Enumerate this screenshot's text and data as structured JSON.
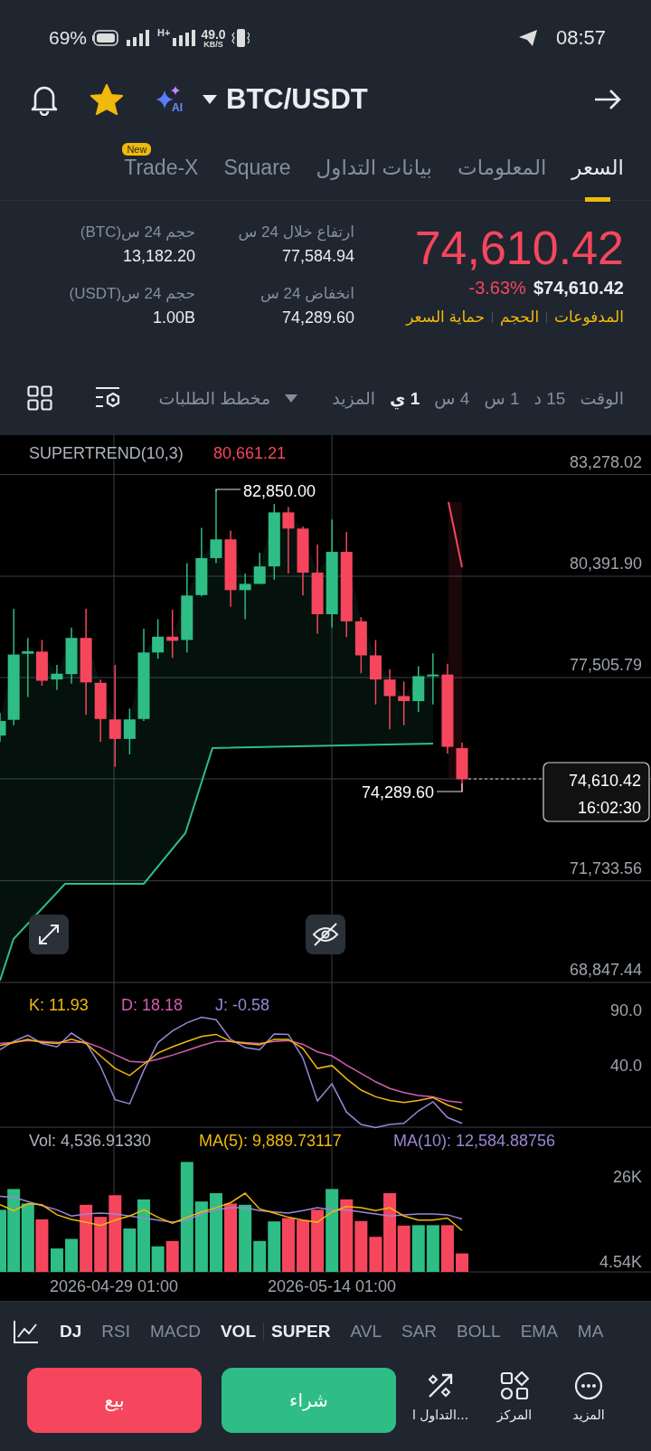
{
  "status_bar": {
    "battery": "69%",
    "network_type": "H+",
    "speed": "49.0",
    "speed_unit": "KB/S",
    "time": "08:57"
  },
  "header": {
    "pair": "BTC/USDT",
    "favorite": true,
    "ai_label": "AI"
  },
  "tabs": [
    {
      "label": "السعر",
      "selected": true
    },
    {
      "label": "المعلومات",
      "selected": false
    },
    {
      "label": "بيانات التداول",
      "selected": false
    },
    {
      "label": "Square",
      "selected": false
    },
    {
      "label": "Trade-X",
      "selected": false,
      "badge": "New"
    }
  ],
  "ticker": {
    "price": "74,610.42",
    "usd_price": "$74,610.42",
    "change": "-3.63%",
    "links": [
      "المدفوعات",
      "الحجم",
      "حماية السعر"
    ]
  },
  "stats": [
    {
      "label": "ارتفاع خلال 24 س",
      "value": "77,584.94"
    },
    {
      "label": "حجم 24 س(BTC)",
      "value": "13,182.20"
    },
    {
      "label": "انخفاض 24 س",
      "value": "74,289.60"
    },
    {
      "label": "حجم 24 س(USDT)",
      "value": "1.00B"
    }
  ],
  "interval_title": "الوقت",
  "intervals": [
    {
      "label": "15 د",
      "selected": false
    },
    {
      "label": "1 س",
      "selected": false
    },
    {
      "label": "4 س",
      "selected": false
    },
    {
      "label": "1 ي",
      "selected": true
    }
  ],
  "more_label": "المزيد",
  "depth_label": "مخطط الطلبات",
  "main_chart": {
    "indicator": "SUPERTREND(10,3)",
    "indicator_value": "80,661.21",
    "price_labels": [
      "83,278.02",
      "80,391.90",
      "77,505.79",
      "71,733.56",
      "68,847.44"
    ],
    "high_label": "82,850.00",
    "low_label": "74,289.60",
    "last_price": "74,610.42",
    "countdown": "16:02:30"
  },
  "kdj": {
    "k": "K: 11.93",
    "d": "D: 18.18",
    "j": "J: -0.58",
    "labels": [
      "90.0",
      "40.0"
    ]
  },
  "volume": {
    "vol": "Vol: 4,536.91330",
    "ma5": "MA(5): 9,889.73117",
    "ma10": "MA(10): 12,584.88756",
    "labels": [
      "26K",
      "4.54K"
    ]
  },
  "dates": [
    "2026-05-14 01:00",
    "2026-04-29 01:00"
  ],
  "sub_indicators": [
    {
      "label": "VOL",
      "selected": true
    },
    {
      "label": "MACD",
      "selected": false
    },
    {
      "label": "RSI",
      "selected": false
    },
    {
      "label": "DJ",
      "selected": true
    }
  ],
  "main_indicators": [
    {
      "label": "MA",
      "selected": false
    },
    {
      "label": "EMA",
      "selected": false
    },
    {
      "label": "BOLL",
      "selected": false
    },
    {
      "label": "SAR",
      "selected": false
    },
    {
      "label": "AVL",
      "selected": false
    },
    {
      "label": "SUPER",
      "selected": true
    }
  ],
  "actions": {
    "sell": "بيع",
    "buy": "شراء",
    "items": [
      {
        "kind": "more",
        "label": "المزيد"
      },
      {
        "kind": "position",
        "label": "المركز"
      },
      {
        "kind": "trade",
        "label": "التداول ا..."
      }
    ]
  }
}
